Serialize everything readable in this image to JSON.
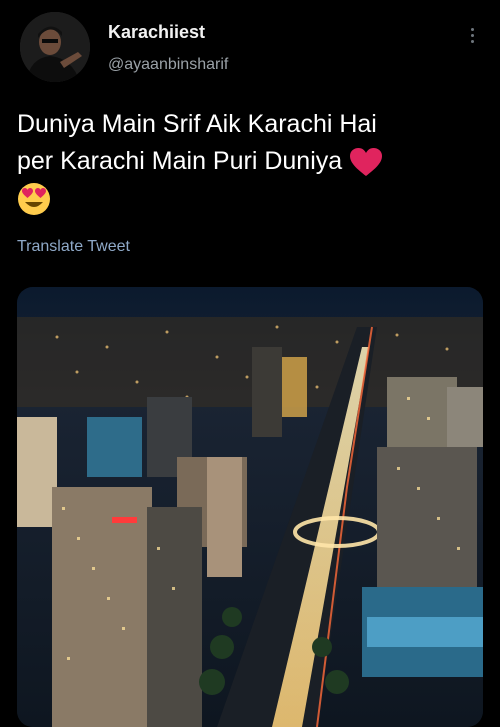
{
  "user": {
    "display_name": "Karachiiest",
    "handle": "@ayaanbinsharif"
  },
  "tweet": {
    "text_line1": "Duniya Main Srif Aik Karachi Hai",
    "text_line2": "per Karachi Main Puri Duniya",
    "emojis": [
      "red-heart",
      "heart-eyes-face"
    ],
    "translate_label": "Translate Tweet"
  },
  "media": {
    "description_icon": "city-night-photo"
  },
  "colors": {
    "background": "#000000",
    "link": "#8fa9c8",
    "heart": "#e0245e",
    "emoji_face": "#ffcc4d"
  }
}
